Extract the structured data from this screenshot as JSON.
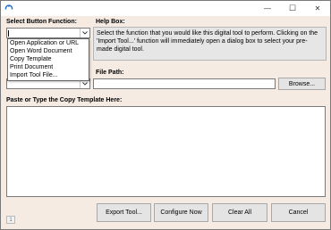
{
  "window": {
    "minimize_glyph": "—",
    "maximize_glyph": "☐",
    "close_glyph": "✕"
  },
  "labels": {
    "select_function": "Select Button Function:",
    "help_box": "Help Box:",
    "file_path": "File Path:",
    "template": "Paste or Type the Copy Template Here:"
  },
  "function_combo": {
    "value": "",
    "options": [
      "Open Application or URL",
      "Open Word Document",
      "Copy Template",
      "Print Document",
      "Import Tool File..."
    ]
  },
  "help_text": "Select the function that you would like this digital tool to perform. Clicking on the 'Import Tool...' function will immediately open a dialog box to select your pre-made digital tool.",
  "file_path": {
    "value": "",
    "browse_label": "Browse..."
  },
  "template_text": "",
  "buttons": {
    "export": "Export Tool...",
    "configure": "Configure Now",
    "clear_all": "Clear All",
    "cancel": "Cancel"
  },
  "status": {
    "indicator": "1"
  },
  "colors": {
    "window_bg": "#f6ebe3",
    "help_bg": "#e6e6e6",
    "button_bg": "#e4e4e4",
    "icon_blue": "#1e6fc8"
  }
}
